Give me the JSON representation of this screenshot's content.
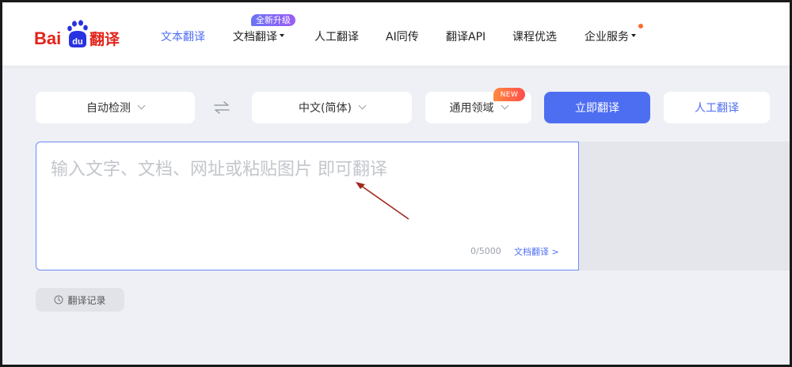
{
  "logo": {
    "brand_text": "Bai",
    "paw_text": "du",
    "product_text": "翻译"
  },
  "nav": {
    "items": [
      {
        "label": "文本翻译"
      },
      {
        "label": "文档翻译"
      },
      {
        "label": "人工翻译"
      },
      {
        "label": "AI同传"
      },
      {
        "label": "翻译API"
      },
      {
        "label": "课程优选"
      },
      {
        "label": "企业服务"
      }
    ],
    "upgrade_badge": "全新升级"
  },
  "toolbar": {
    "source_lang": "自动检测",
    "target_lang": "中文(简体)",
    "domain": "通用领域",
    "new_badge": "NEW",
    "translate_button": "立即翻译",
    "human_button": "人工翻译"
  },
  "input": {
    "placeholder": "输入文字、文档、网址或粘贴图片 即可翻译",
    "value": "",
    "counter": "0/5000",
    "doc_link": "文档翻译 >"
  },
  "history": {
    "label": "翻译记录"
  },
  "colors": {
    "accent": "#4e6ef2",
    "logo_red": "#e2231a",
    "logo_blue": "#2932e1",
    "badge_purple": "#7b6cf5",
    "badge_orange": "#ff6a2a",
    "annotation_arrow": "#a0281e"
  },
  "icons": [
    "paw-logo-icon",
    "chevron-down-icon",
    "swap-icon",
    "clock-icon",
    "arrow-annotation-icon"
  ]
}
